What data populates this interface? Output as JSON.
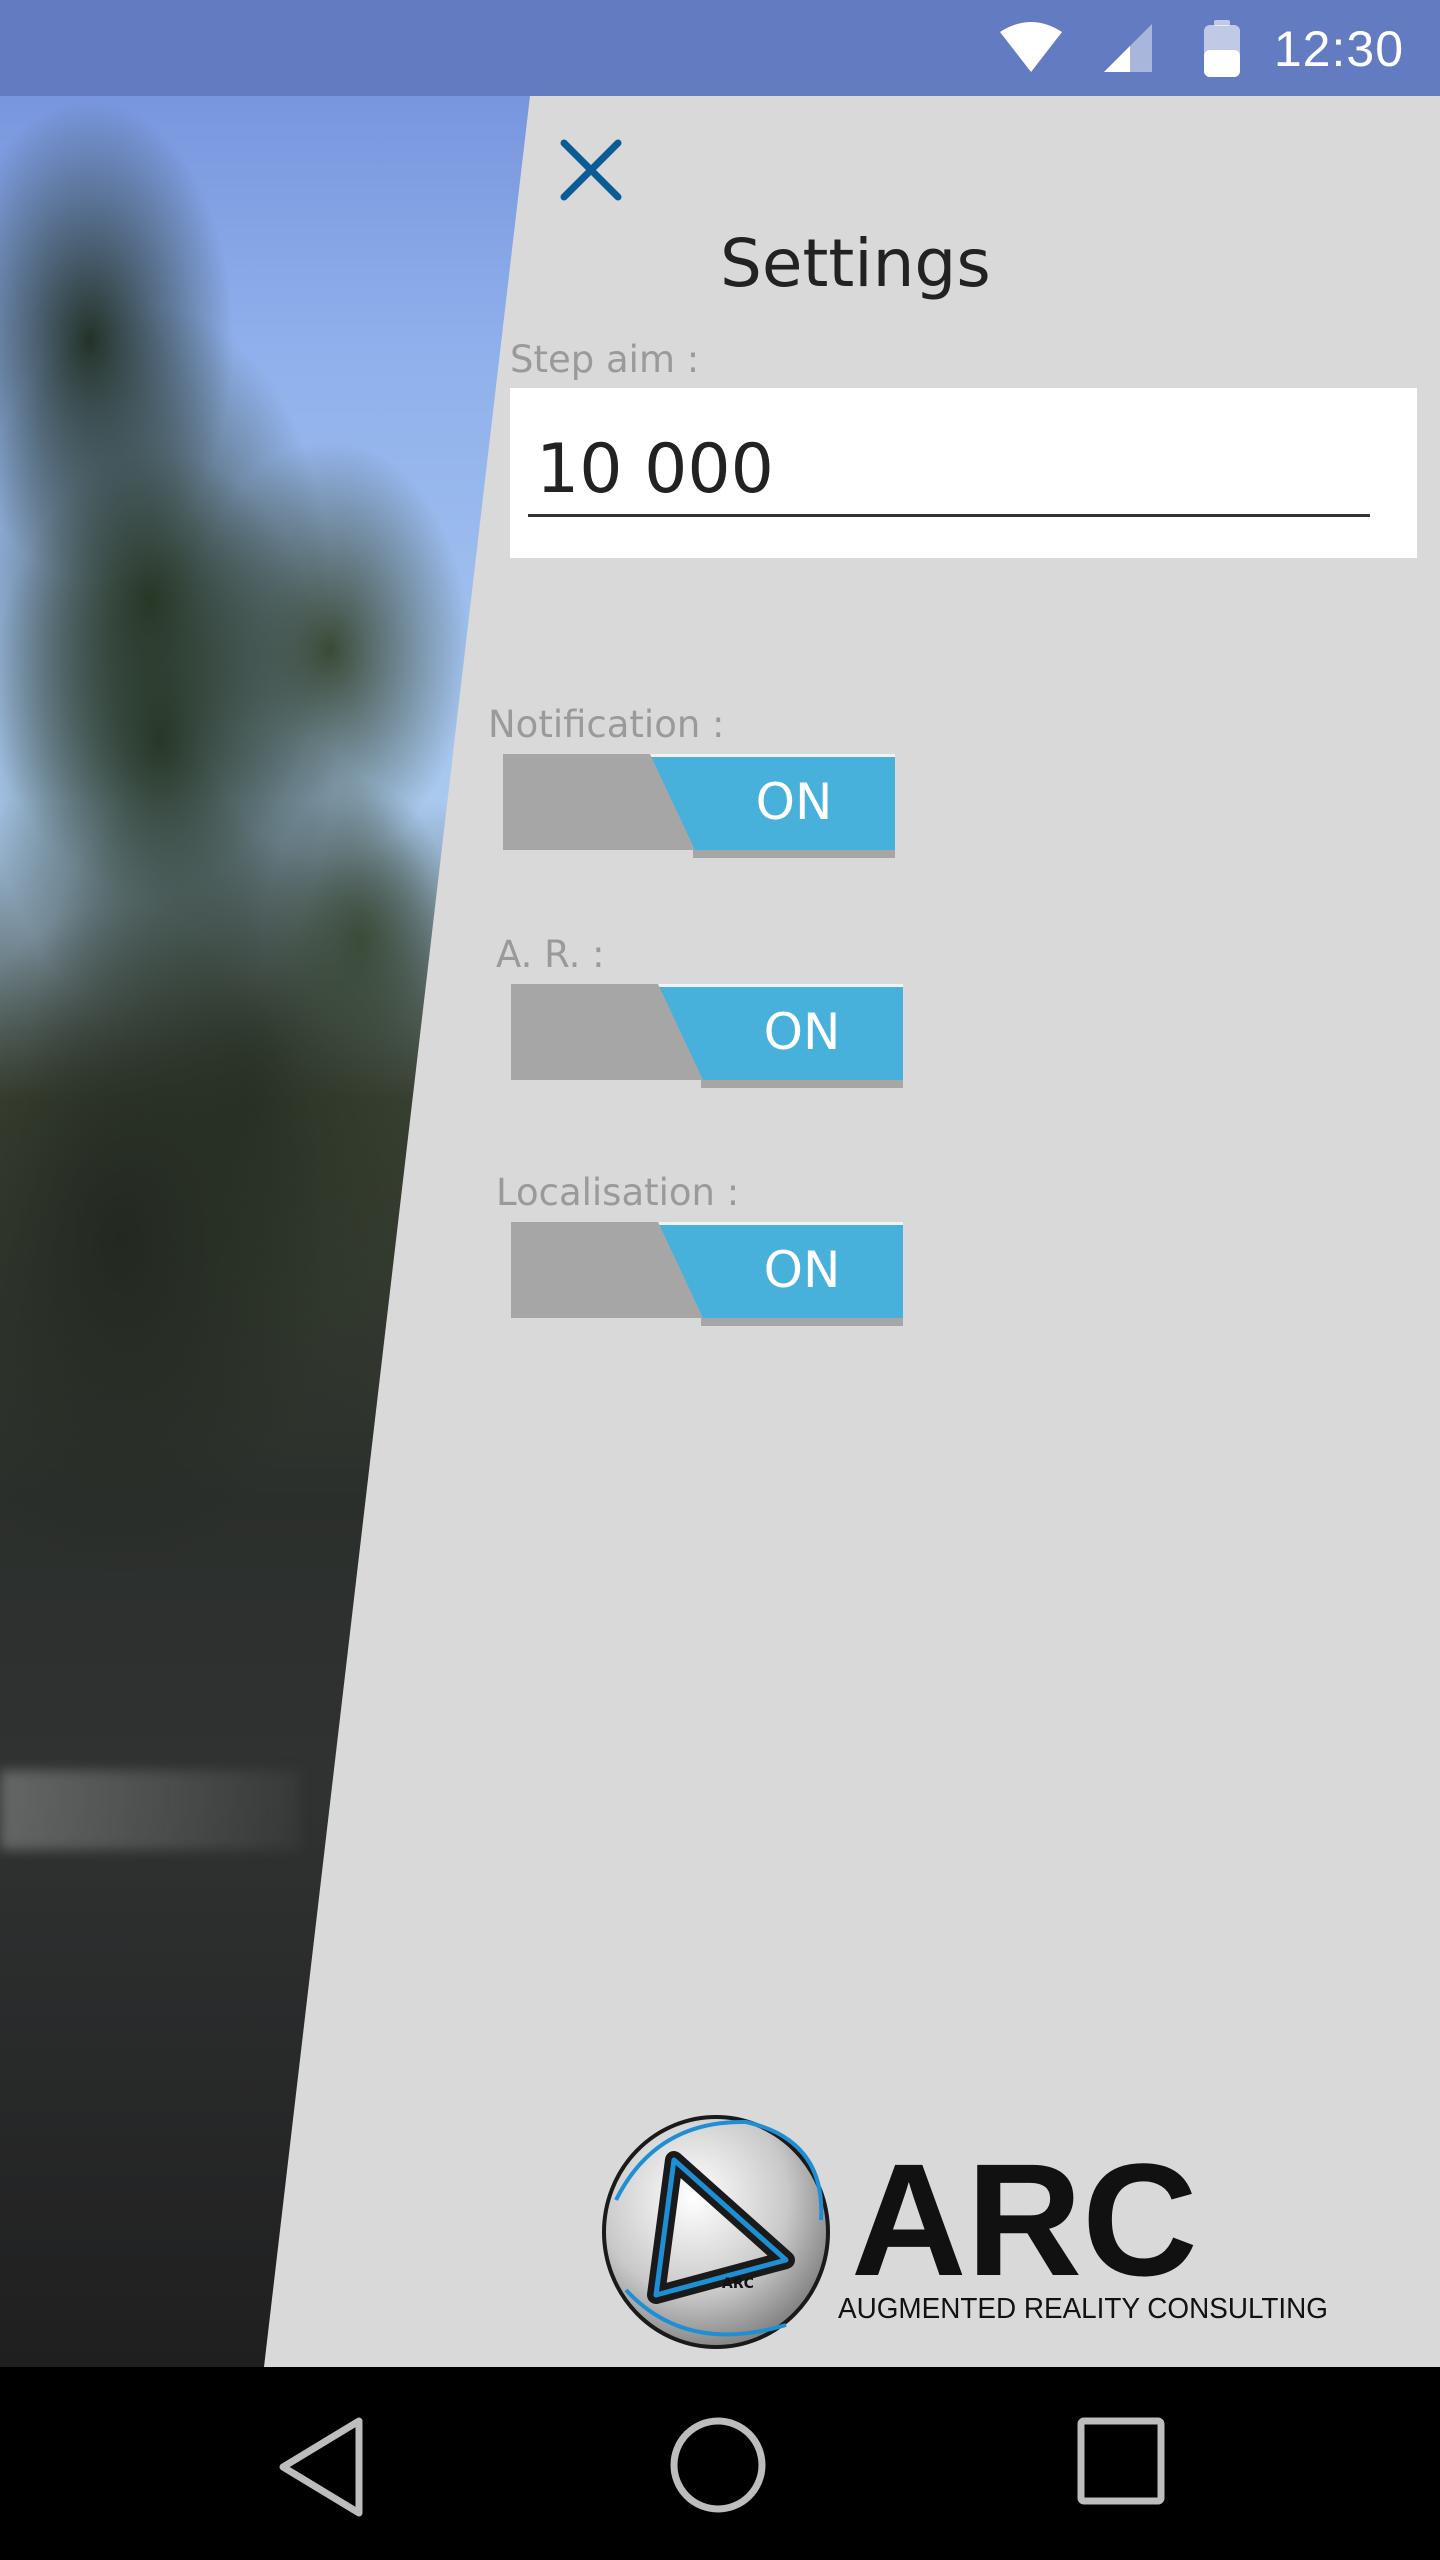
{
  "status_bar": {
    "time": "12:30",
    "icons": [
      "wifi-icon",
      "cell-signal-icon",
      "battery-icon"
    ]
  },
  "settings": {
    "title": "Settings",
    "close_icon": "close-icon",
    "step_aim": {
      "label": "Step aim :",
      "value": "10 000"
    },
    "notification": {
      "label": "Notification :",
      "state": "ON"
    },
    "ar": {
      "label": "A. R. :",
      "state": "ON"
    },
    "localisation": {
      "label": "Localisation :",
      "state": "ON"
    }
  },
  "logo": {
    "wordmark": "ARC",
    "tagline": "AUGMENTED REALITY CONSULTING",
    "emblem_text": "ARC"
  },
  "nav_bar": {
    "buttons": [
      "back-icon",
      "home-icon",
      "recents-icon"
    ]
  },
  "colors": {
    "status_bar": "#627abe",
    "panel": "#d9d9d9",
    "toggle_on": "#47b1dc",
    "toggle_off": "#a6a6a6",
    "close_icon": "#0a5d94",
    "logo_blue": "#1f8fd4"
  }
}
